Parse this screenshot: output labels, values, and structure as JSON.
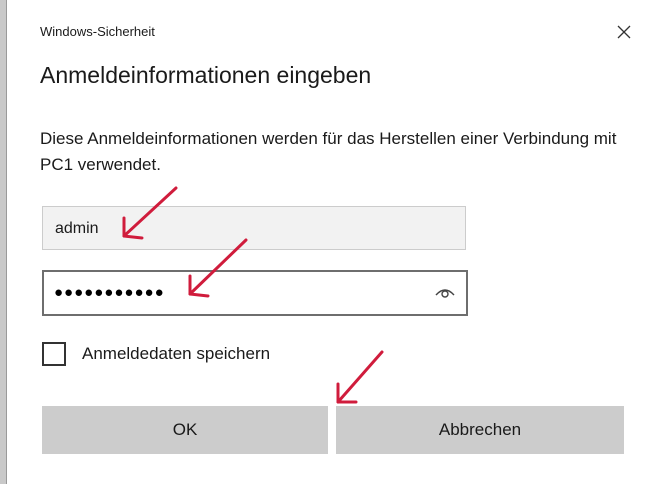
{
  "window": {
    "title": "Windows-Sicherheit"
  },
  "dialog": {
    "heading": "Anmeldeinformationen eingeben",
    "description": "Diese Anmeldeinformationen werden für das Herstellen einer Verbindung mit PC1 verwendet."
  },
  "username_field": {
    "value": "admin"
  },
  "password_field": {
    "value": "●●●●●●●●●●●"
  },
  "remember_checkbox": {
    "label": "Anmeldedaten speichern",
    "checked": false
  },
  "buttons": {
    "ok_label": "OK",
    "cancel_label": "Abbrechen"
  },
  "icons": {
    "close": "close-icon",
    "reveal_password": "eye-icon"
  },
  "colors": {
    "annotation_arrow": "#d01c3c",
    "button_bg": "#cccccc",
    "input_border": "#6e6e6e"
  }
}
